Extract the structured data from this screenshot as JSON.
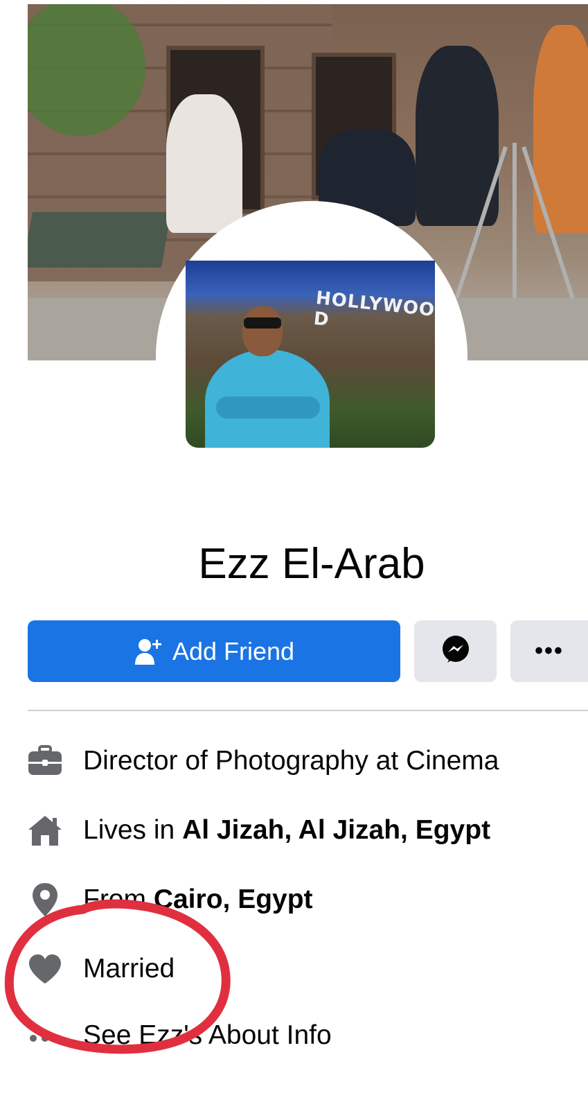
{
  "profile": {
    "name": "Ezz El-Arab",
    "cover_sign_text": "HOLLYWOO D"
  },
  "actions": {
    "add_friend_label": "Add Friend",
    "more_label": "•••"
  },
  "info": [
    {
      "icon": "briefcase-icon",
      "prefix": "Director of Photography at Cinema",
      "bold": ""
    },
    {
      "icon": "home-icon",
      "prefix": "Lives in ",
      "bold": "Al Jizah, Al Jizah, Egypt"
    },
    {
      "icon": "location-pin-icon",
      "prefix": "From ",
      "bold": "Cairo, Egypt"
    },
    {
      "icon": "heart-icon",
      "prefix": "Married",
      "bold": ""
    },
    {
      "icon": "more-dots-icon",
      "prefix": "See Ezz's About Info",
      "bold": ""
    }
  ],
  "colors": {
    "primary": "#1b74e4",
    "secondary_button": "#e4e6eb",
    "icon_gray": "#65676b",
    "annotation_red": "#e0303f"
  }
}
